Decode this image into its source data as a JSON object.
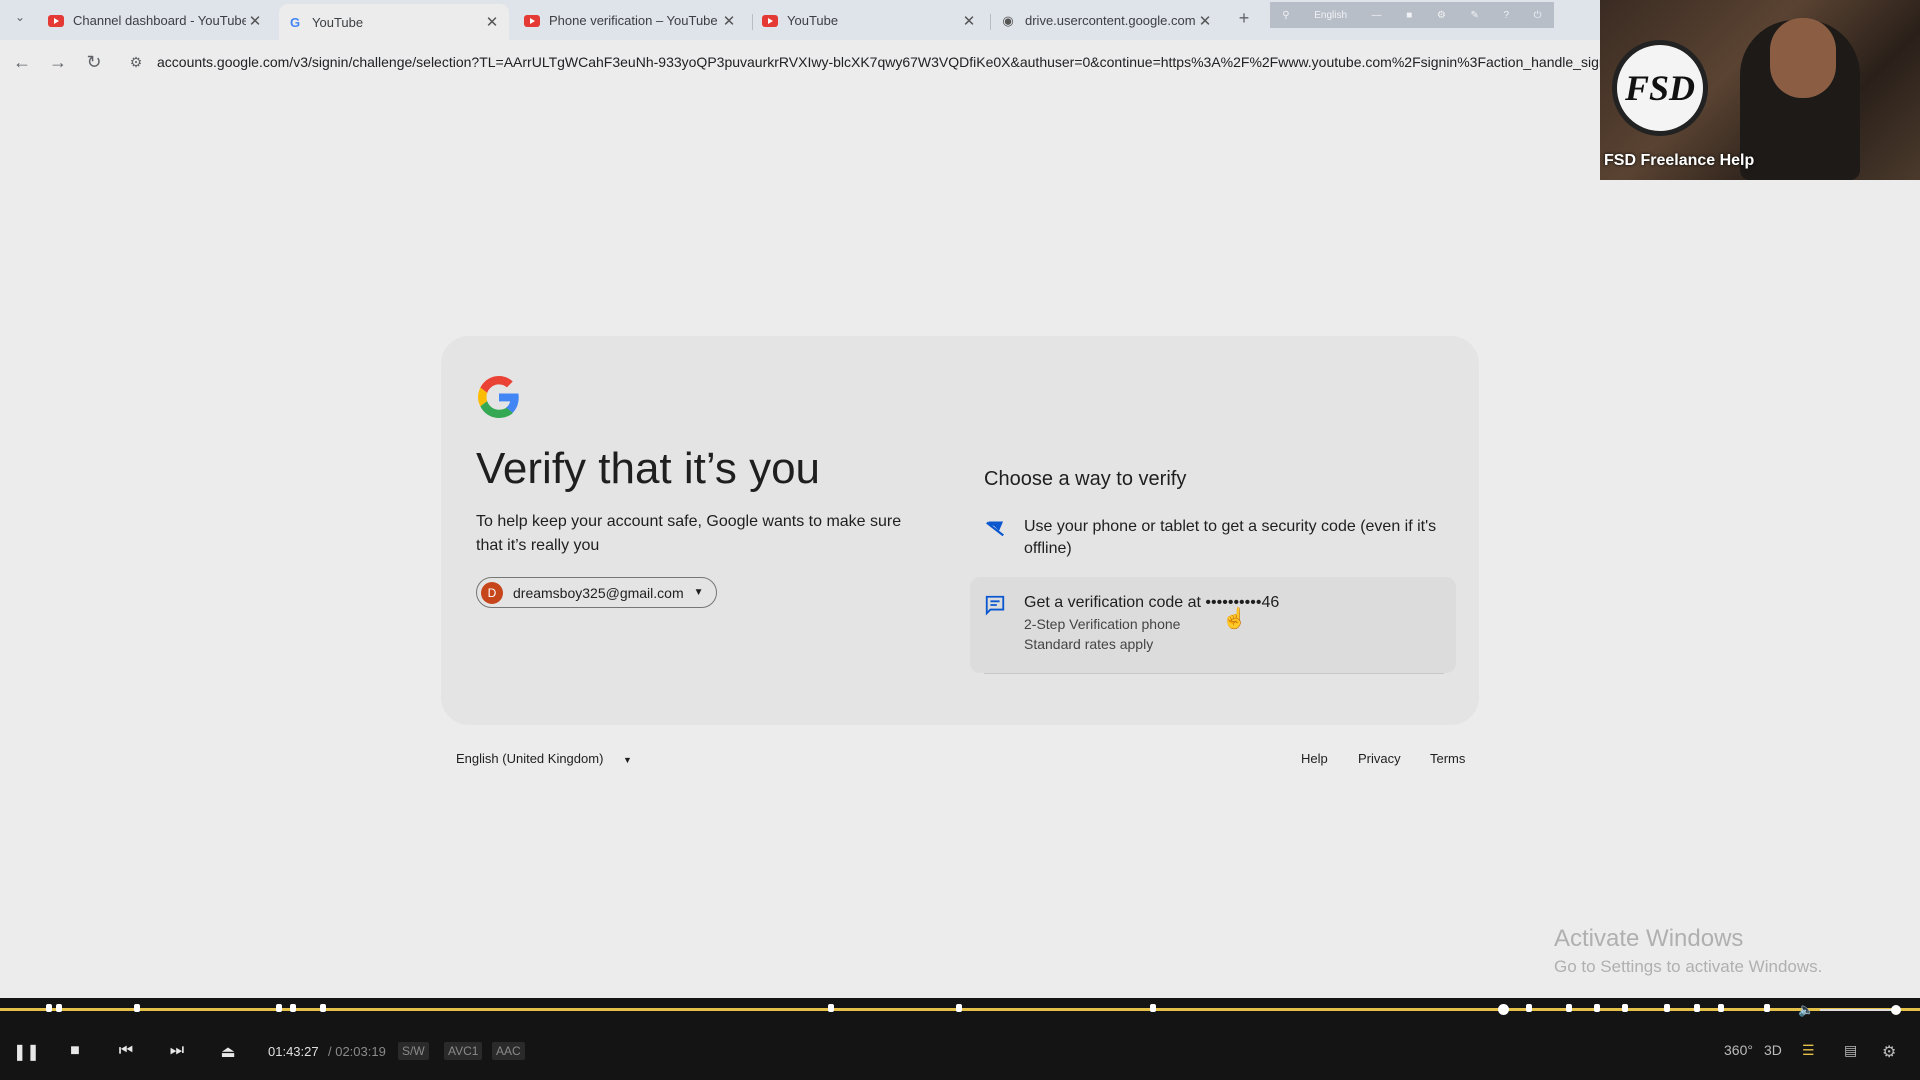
{
  "browser": {
    "tabs": [
      {
        "title": "Channel dashboard - YouTube",
        "favicon": "youtube-icon"
      },
      {
        "title": "YouTube",
        "favicon": "google-icon",
        "active": true
      },
      {
        "title": "Phone verification – YouTube",
        "favicon": "youtube-icon"
      },
      {
        "title": "YouTube",
        "favicon": "youtube-icon"
      },
      {
        "title": "drive.usercontent.google.com",
        "favicon": "globe-icon"
      }
    ],
    "overlay_toolbar": {
      "language": "English"
    },
    "url": "accounts.google.com/v3/signin/challenge/selection?TL=AArrULTgWCahF3euNh-933yoQP3puvaurkrRVXIwy-blcXK7qwy67W3VQDfiKe0X&authuser=0&continue=https%3A%2F%2Fwww.youtube.com%2Fsignin%3Faction_handle_signin%"
  },
  "webcam": {
    "logo_text": "FSD",
    "name": "FSD Freelance Help"
  },
  "signin": {
    "title": "Verify that it’s you",
    "subtitle": "To help keep your account safe, Google wants to make sure that it’s really you",
    "account": {
      "initial": "D",
      "email": "dreamsboy325@gmail.com"
    },
    "choose_heading": "Choose a way to verify",
    "options": [
      {
        "icon": "phone-prompt-icon",
        "text": "Use your phone or tablet to get a security code (even if it's offline)"
      },
      {
        "icon": "message-icon",
        "text": "Get a verification code at ••••••••••46",
        "line2": "2-Step Verification phone",
        "line3": "Standard rates apply"
      }
    ],
    "footer": {
      "language": "English (United Kingdom)",
      "links": [
        "Help",
        "Privacy",
        "Terms"
      ]
    }
  },
  "watermark": {
    "line1": "Activate Windows",
    "line2": "Go to Settings to activate Windows."
  },
  "player": {
    "current_time": "01:43:27",
    "duration": "/ 02:03:19",
    "badges": [
      "S/W",
      "AVC1",
      "AAC"
    ],
    "progress": 0.8389,
    "volume": 0.95,
    "right_controls": [
      "360°",
      "3D"
    ]
  },
  "colors": {
    "accent": "#e6c14a",
    "card": "#e4e4e4",
    "player_bg": "#141414"
  }
}
